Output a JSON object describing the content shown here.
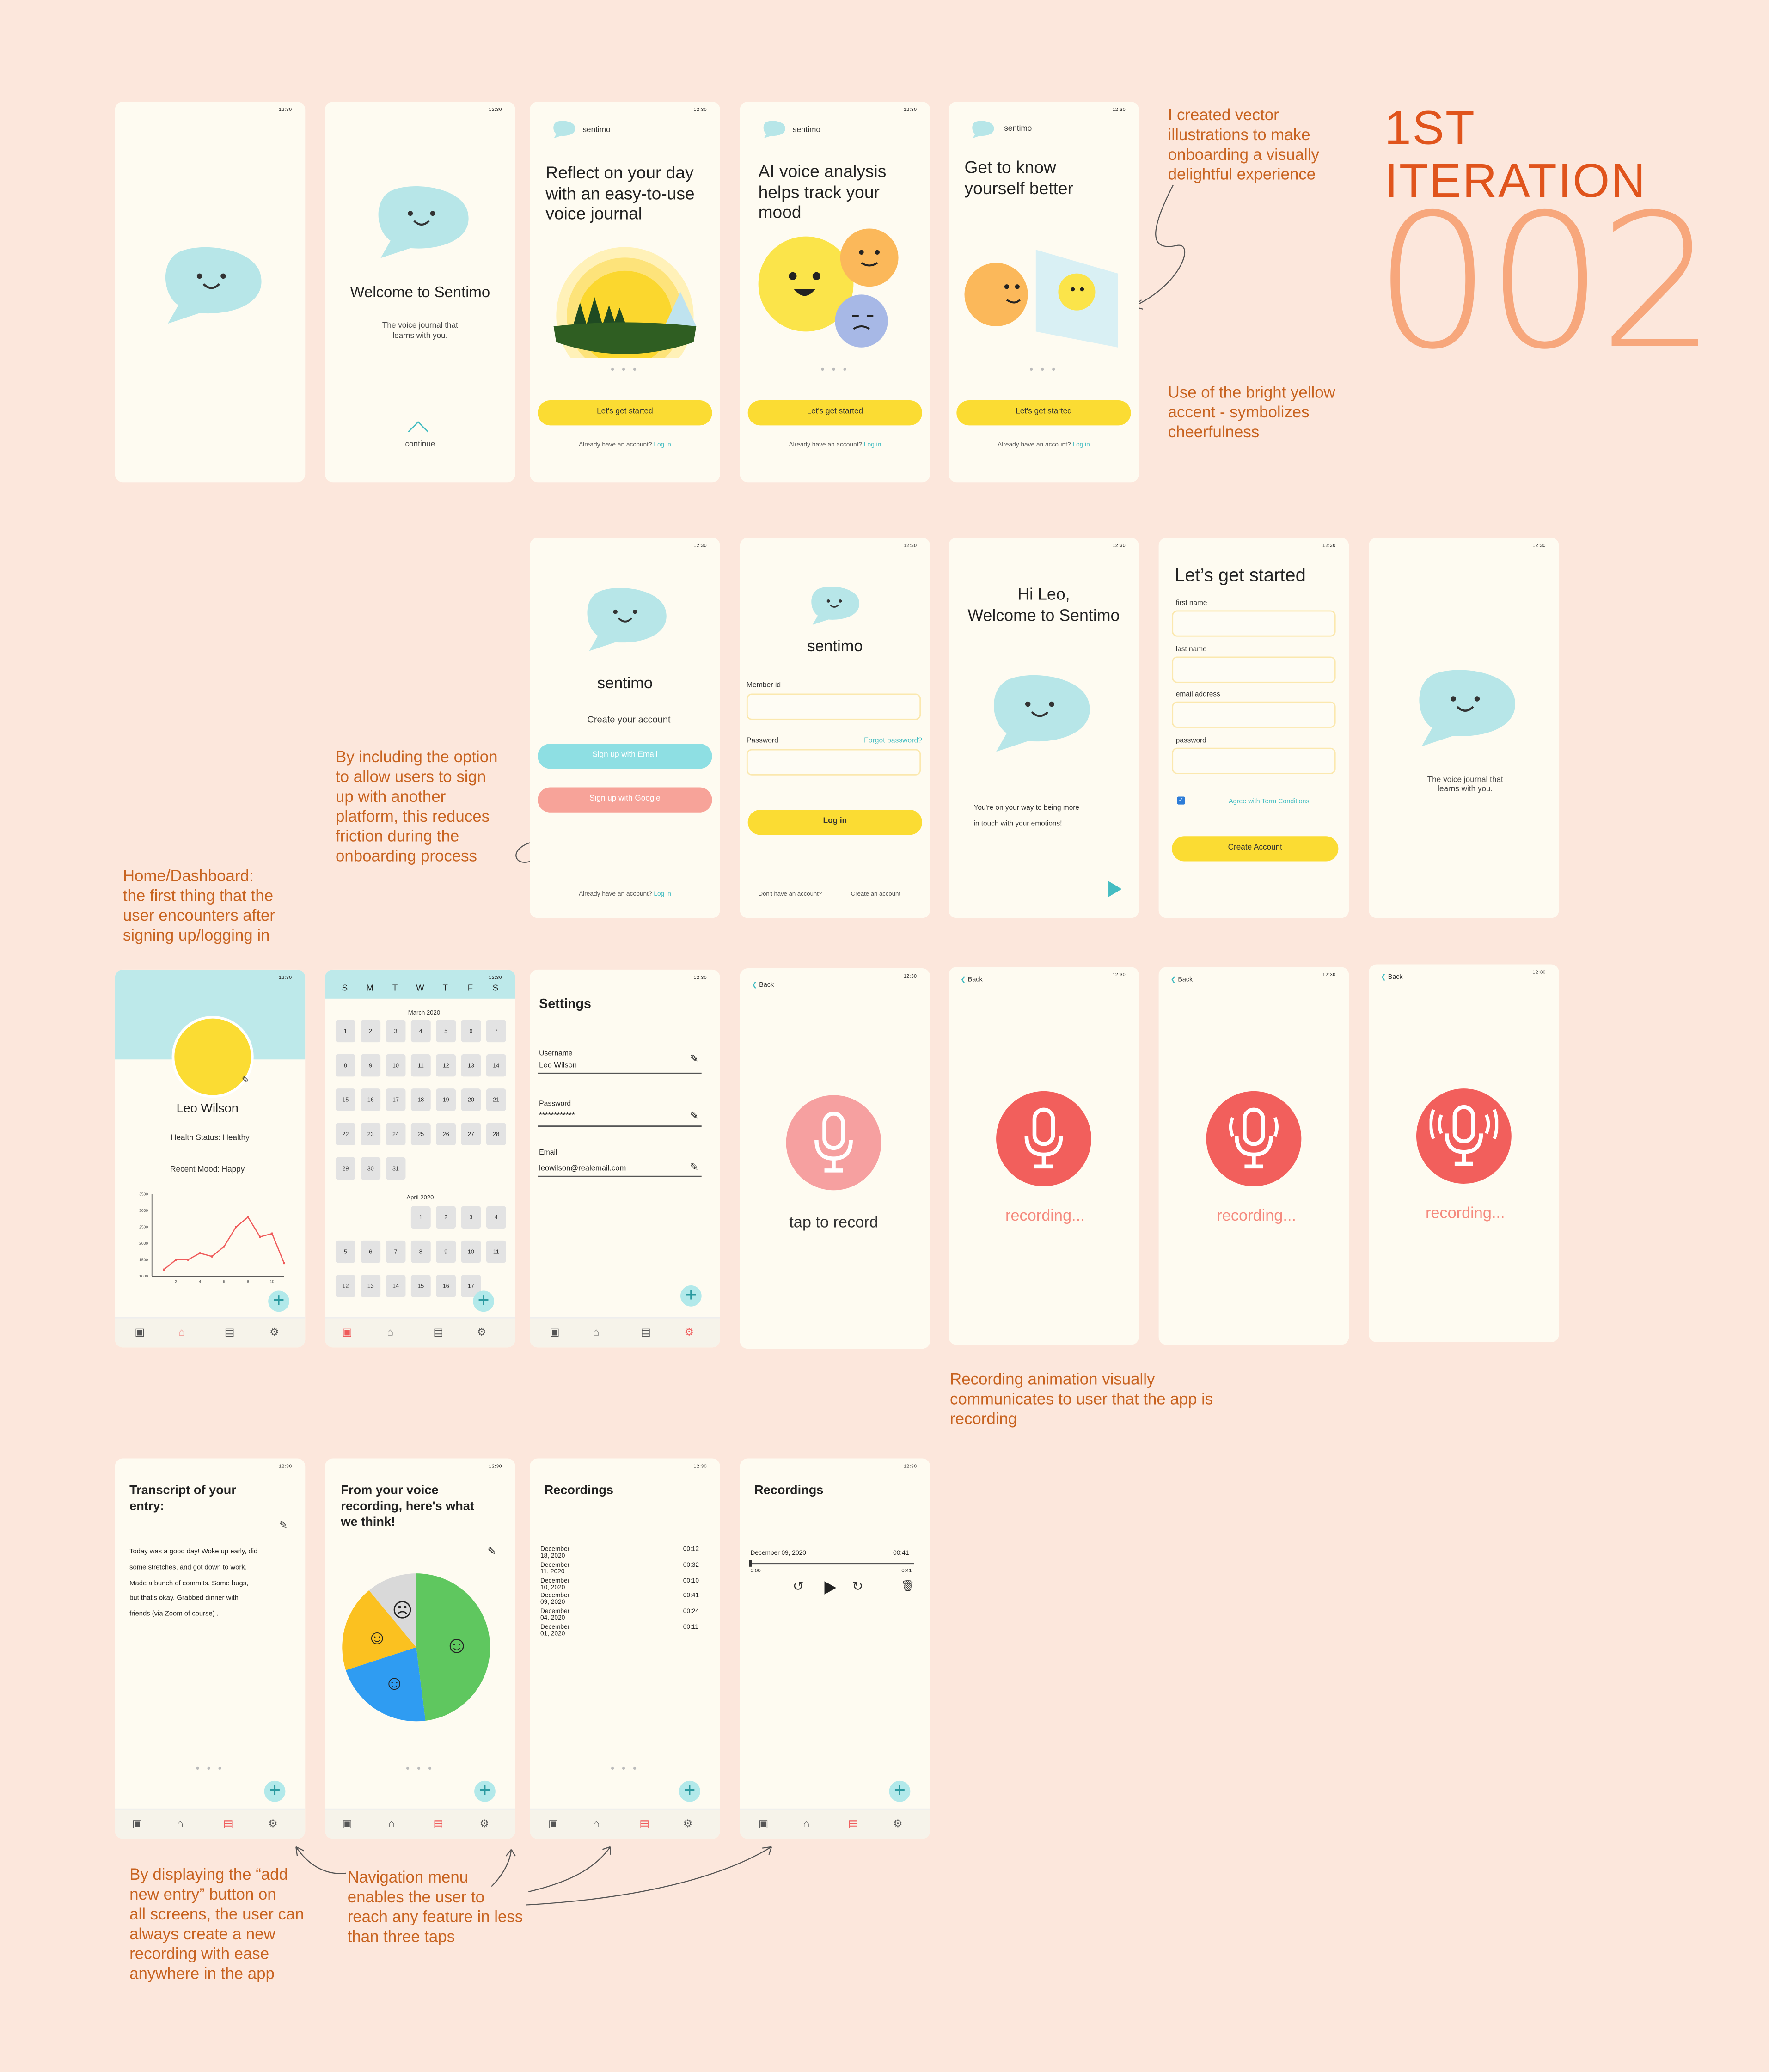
{
  "status_time": "12:30",
  "brand": {
    "name": "sentimo",
    "accent": "#fbdc33",
    "teal": "#b2e9ea",
    "mic": "#f25f5c",
    "note_color": "#c86320"
  },
  "title": {
    "line1": "1ST",
    "line2": "ITERATION",
    "number": "002"
  },
  "notes": {
    "vector": [
      "I created vector",
      "illustrations to make",
      "onboarding a visually",
      "delightful experience"
    ],
    "yellow": [
      "Use of the bright yellow",
      "accent - symbolizes",
      "cheerfulness"
    ],
    "signin": [
      "By including the option",
      "to allow users to sign",
      "up with another",
      "platform, this reduces",
      "friction during the",
      "onboarding process"
    ],
    "home": [
      "Home/Dashboard:",
      "the first thing that the",
      "user encounters after",
      "signing up/logging in"
    ],
    "recording": [
      "Recording animation visually",
      "communicates to user that the app is",
      "recording"
    ],
    "add": [
      "By displaying the “add",
      "new entry” button on",
      "all screens, the user can",
      "always create a new",
      "recording with ease",
      "anywhere in the app"
    ],
    "navmenu": [
      "Navigation menu",
      "enables the user to",
      "reach any feature in less",
      "than three taps"
    ]
  },
  "welcome": {
    "title": "Welcome to Sentimo",
    "subtitle1": "The voice journal that",
    "subtitle2": "learns with you.",
    "continue": "continue"
  },
  "onboarding": [
    {
      "title1": "Reflect on your day",
      "title2": "with an easy-to-use",
      "title3": "voice journal"
    },
    {
      "title1": "AI voice analysis",
      "title2": "helps track your",
      "title3": "mood"
    },
    {
      "title1": "Get to know",
      "title2": "yourself better",
      "title3": ""
    }
  ],
  "cta": {
    "start": "Let's get started",
    "have_account": "Already have an account?",
    "login_link": "Log in"
  },
  "create": {
    "heading": "Create your account",
    "email": "Sign up with Email",
    "google": "Sign up with Google"
  },
  "login": {
    "member_label": "Member id",
    "password_label": "Password",
    "forgot": "Forgot password?",
    "button": "Log in",
    "no_account": "Don't have an account?",
    "create_link": "Create an account"
  },
  "hi": {
    "line1": "Hi Leo,",
    "line2": "Welcome to Sentimo",
    "msg1": "You're on your way to being more",
    "msg2": "in touch with your emotions!"
  },
  "signup": {
    "title": "Let’s get started",
    "first": "first name",
    "last": "last name",
    "email": "email address",
    "password": "password",
    "agree": "Agree with Term Conditions",
    "button": "Create Account"
  },
  "splash2": {
    "line1": "The voice journal that",
    "line2": "learns with you."
  },
  "profile": {
    "name": "Leo Wilson",
    "health": "Health Status: Healthy",
    "mood": "Recent Mood: Happy"
  },
  "calendar": {
    "weekdays": [
      "S",
      "M",
      "T",
      "W",
      "T",
      "F",
      "S"
    ],
    "month1": "March 2020",
    "month2": "April 2020",
    "march": [
      "1",
      "2",
      "3",
      "4",
      "5",
      "6",
      "7",
      "8",
      "9",
      "10",
      "11",
      "12",
      "13",
      "14",
      "15",
      "16",
      "17",
      "18",
      "19",
      "20",
      "21",
      "22",
      "23",
      "24",
      "25",
      "26",
      "27",
      "28",
      "29",
      "30",
      "31"
    ],
    "april": [
      "1",
      "2",
      "3",
      "4",
      "5",
      "6",
      "7",
      "8",
      "9",
      "10",
      "11",
      "12",
      "13",
      "14",
      "15",
      "16",
      "17"
    ]
  },
  "settings": {
    "title": "Settings",
    "username_label": "Username",
    "username": "Leo Wilson",
    "password_label": "Password",
    "password": "************",
    "email_label": "Email",
    "email": "leowilson@realemail.com"
  },
  "record": {
    "back": "Back",
    "tap": "tap to record",
    "recording": "recording..."
  },
  "transcript": {
    "title1": "Transcript of your",
    "title2": "entry:",
    "lines": [
      "Today was a good day! Woke up early, did",
      "some stretches, and got down to work.",
      "Made a bunch of commits. Some bugs,",
      "but that's okay. Grabbed dinner with",
      "friends (via Zoom of course) ."
    ]
  },
  "analysis": {
    "title1": "From your voice",
    "title2": "recording, here's what",
    "title3": "we think!"
  },
  "recordings": {
    "title": "Recordings",
    "items": [
      {
        "date": "December 18, 2020",
        "dur": "00:12"
      },
      {
        "date": "December 11, 2020",
        "dur": "00:32"
      },
      {
        "date": "December 10, 2020",
        "dur": "00:10"
      },
      {
        "date": "December 09, 2020",
        "dur": "00:41"
      },
      {
        "date": "December 04, 2020",
        "dur": "00:24"
      },
      {
        "date": "December 01, 2020",
        "dur": "00:11"
      }
    ],
    "player": {
      "date": "December 09, 2020",
      "dur": "00:41",
      "start": "0:00",
      "end": "-0:41"
    }
  },
  "chart_data": {
    "type": "line",
    "y_ticks": [
      "3500",
      "3000",
      "2500",
      "2000",
      "1500",
      "1000"
    ],
    "x_ticks": [
      "2",
      "4",
      "6",
      "8",
      "10"
    ],
    "x": [
      1,
      2,
      3,
      4,
      5,
      6,
      7,
      8,
      9,
      10,
      11
    ],
    "values": [
      1200,
      1500,
      1500,
      1700,
      1600,
      1900,
      2500,
      2800,
      2200,
      2300,
      1400
    ],
    "ylim": [
      1000,
      3500
    ]
  },
  "pie": {
    "values": [
      48,
      22,
      19,
      11
    ],
    "colors": [
      "#5fc75f",
      "#2f9cf2",
      "#fbc120",
      "#d9d9d9"
    ]
  }
}
